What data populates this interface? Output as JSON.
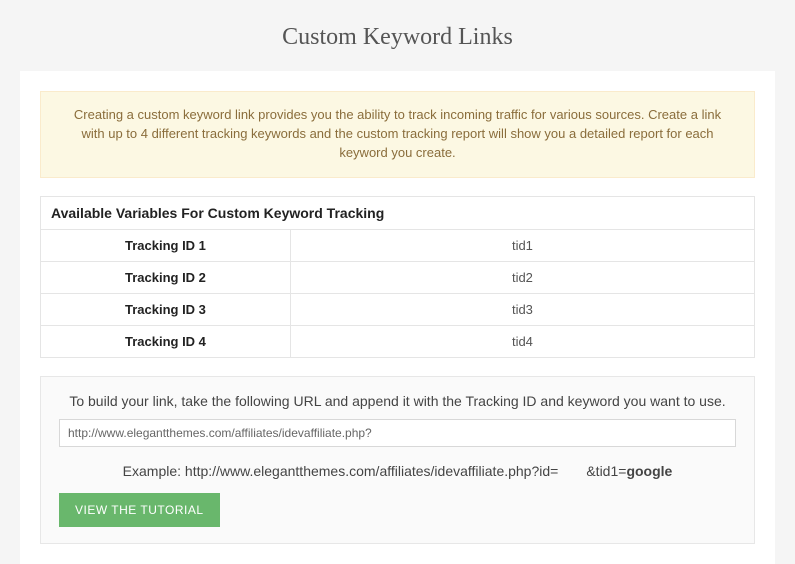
{
  "title": "Custom Keyword Links",
  "alert_text": "Creating a custom keyword link provides you the ability to track incoming traffic for various sources. Create a link with up to 4 different tracking keywords and the custom tracking report will show you a detailed report for each keyword you create.",
  "table": {
    "header": "Available Variables For Custom Keyword Tracking",
    "rows": [
      {
        "label": "Tracking ID 1",
        "value": "tid1"
      },
      {
        "label": "Tracking ID 2",
        "value": "tid2"
      },
      {
        "label": "Tracking ID 3",
        "value": "tid3"
      },
      {
        "label": "Tracking ID 4",
        "value": "tid4"
      }
    ]
  },
  "builder": {
    "instruction": "To build your link, take the following URL and append it with the Tracking ID and keyword you want to use.",
    "url_value": "http://www.elegantthemes.com/affiliates/idevaffiliate.php?",
    "example_prefix": "Example: http://www.elegantthemes.com/affiliates/idevaffiliate.php?id=",
    "example_gap": "  ",
    "example_param_key": "&tid1=",
    "example_param_value": "google",
    "button_label": "VIEW THE TUTORIAL"
  }
}
